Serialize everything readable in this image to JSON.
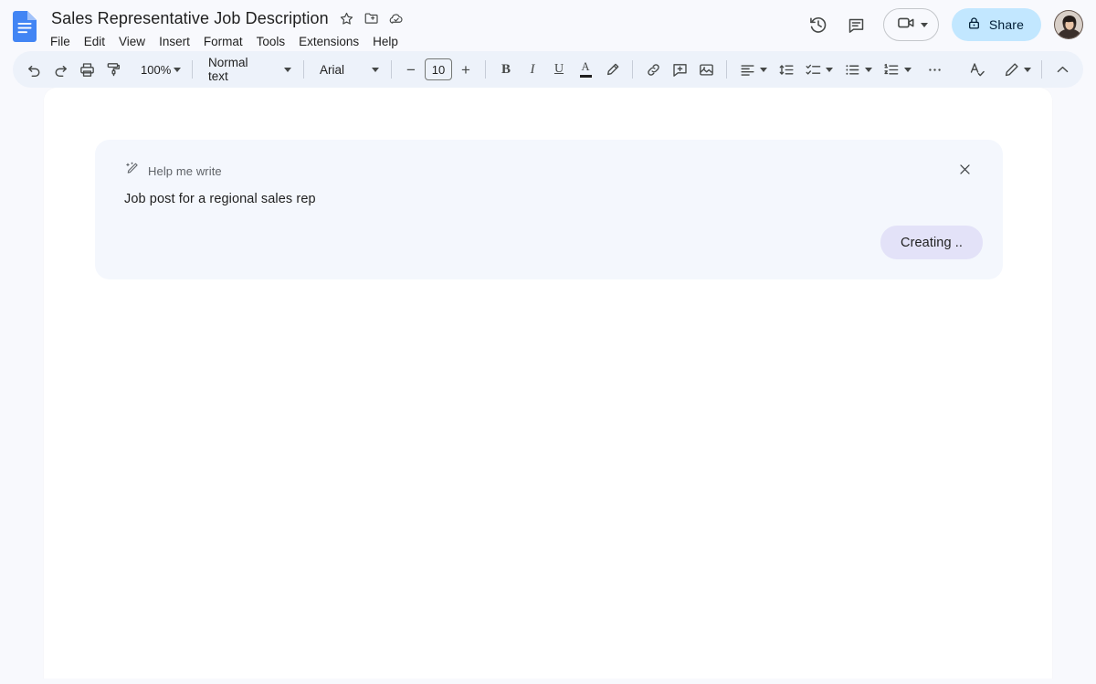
{
  "app": {
    "name": "Google Docs",
    "logo_icon": "docs-file-icon"
  },
  "header": {
    "doc_title": "Sales Representative Job Description",
    "title_actions": [
      {
        "icon": "star-icon",
        "name": "star-document"
      },
      {
        "icon": "folder-move-icon",
        "name": "move-to-folder"
      },
      {
        "icon": "cloud-saved-icon",
        "name": "document-saved-to-drive"
      }
    ],
    "menus": [
      "File",
      "Edit",
      "View",
      "Insert",
      "Format",
      "Tools",
      "Extensions",
      "Help"
    ],
    "right_actions": {
      "history_icon": "version-history-icon",
      "comments_icon": "comment-history-icon",
      "meet_icon": "video-camera-icon",
      "meet_caret": "chevron-down-icon",
      "share_label": "Share",
      "share_icon": "lock-icon",
      "avatar_name": "user-avatar"
    }
  },
  "toolbar": {
    "undo": "undo-icon",
    "redo": "redo-icon",
    "print": "print-icon",
    "paint_format": "paint-format-icon",
    "zoom_value": "100%",
    "paragraph_style": "Normal text",
    "font_family": "Arial",
    "font_size": "10",
    "decrease_label": "−",
    "increase_label": "+",
    "bold": "B",
    "italic": "I",
    "underline": "U",
    "text_color": "A",
    "highlight_icon": "highlight-pen-icon",
    "link_icon": "insert-link-icon",
    "comment_icon": "add-comment-icon",
    "image_icon": "insert-image-icon",
    "align_icon": "align-left-icon",
    "line_spacing_icon": "line-spacing-icon",
    "checklist_icon": "checklist-icon",
    "bulleted_icon": "bulleted-list-icon",
    "numbered_icon": "numbered-list-icon",
    "more_icon": "more-options-icon",
    "spellcheck_icon": "spellcheck-icon",
    "editing_mode_icon": "editing-pencil-icon",
    "collapse_icon": "chevron-up-icon"
  },
  "help_me_write": {
    "label": "Help me write",
    "label_icon": "magic-pen-icon",
    "prompt": "Job post for a regional sales rep",
    "close_icon": "close-icon",
    "action_label": "Creating ..",
    "action_bg": "#e3e2f8"
  },
  "colors": {
    "app_bg": "#f8f9fd",
    "toolbar_bg": "#edf2fa",
    "page_bg": "#ffffff",
    "share_bg": "#c2e7ff",
    "card_bg": "#f4f7fd",
    "docs_blue": "#1a73e8"
  }
}
